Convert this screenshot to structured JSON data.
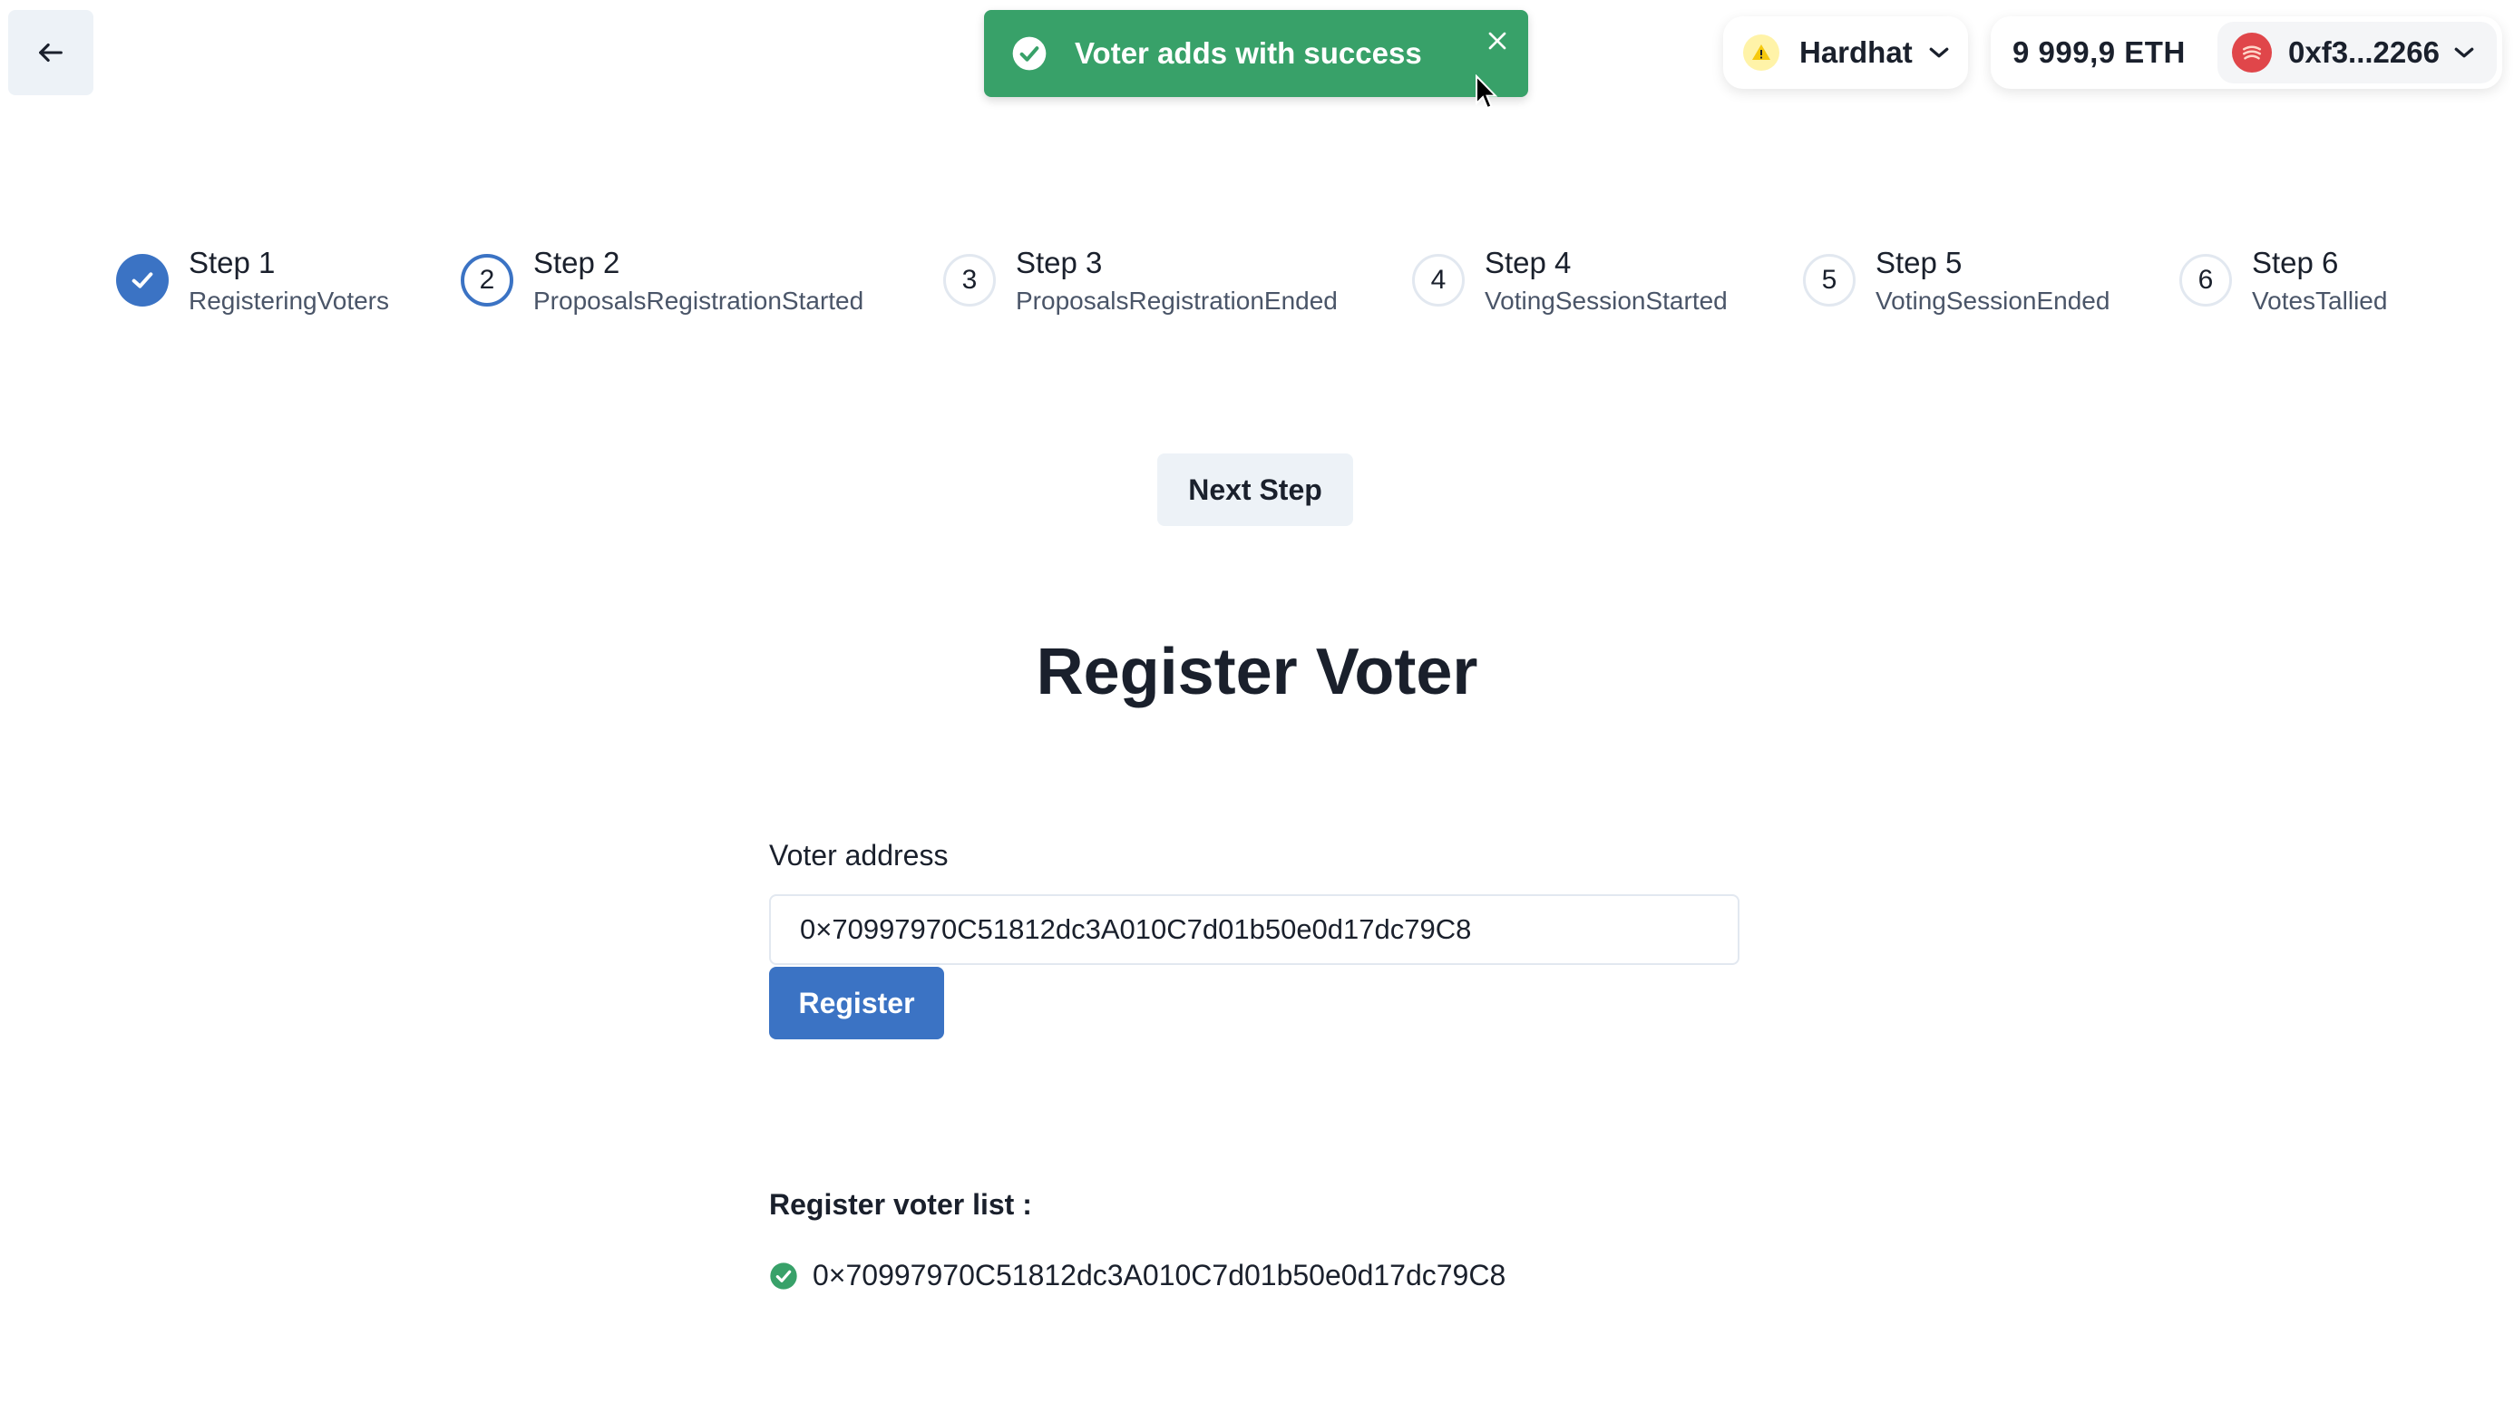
{
  "toast": {
    "message": "Voter adds with success",
    "color": "#38a169"
  },
  "header": {
    "network": "Hardhat",
    "balance": "9 999,9 ETH",
    "account": "0xf3...2266"
  },
  "steps": [
    {
      "title": "Step 1",
      "desc": "RegisteringVoters",
      "marker": "",
      "state": "done"
    },
    {
      "title": "Step 2",
      "desc": "ProposalsRegistrationStarted",
      "marker": "2",
      "state": "active"
    },
    {
      "title": "Step 3",
      "desc": "ProposalsRegistrationEnded",
      "marker": "3",
      "state": "todo"
    },
    {
      "title": "Step 4",
      "desc": "VotingSessionStarted",
      "marker": "4",
      "state": "todo"
    },
    {
      "title": "Step 5",
      "desc": "VotingSessionEnded",
      "marker": "5",
      "state": "todo"
    },
    {
      "title": "Step 6",
      "desc": "VotesTallied",
      "marker": "6",
      "state": "todo"
    }
  ],
  "next_step_label": "Next Step",
  "page_title": "Register Voter",
  "form": {
    "label": "Voter address",
    "value": "0×70997970C51812dc3A010C7d01b50e0d17dc79C8",
    "button": "Register"
  },
  "voter_list": {
    "title": "Register voter list :",
    "items": [
      "0×70997970C51812dc3A010C7d01b50e0d17dc79C8"
    ]
  },
  "colors": {
    "accent": "#3b73c4",
    "success": "#38a169"
  }
}
